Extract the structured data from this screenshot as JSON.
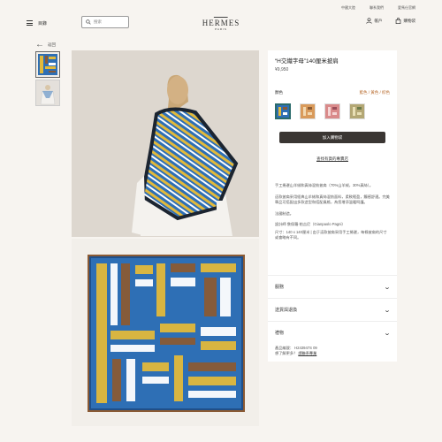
{
  "topbar": {
    "links": [
      "中國大陸",
      "聯系我們",
      "愛馬仕官網"
    ]
  },
  "header": {
    "menu_label": "目錄",
    "search_placeholder": "搜索",
    "logo_main": "HERMES",
    "logo_sub": "PARIS",
    "account_label": "帳戶",
    "cart_label": "購物袋"
  },
  "back": {
    "label": "返回"
  },
  "product": {
    "title": "“H交織字母”140厘米披肩",
    "price": "¥9,950",
    "color_heading": "顏色",
    "color_value": "藍色 / 黃色 / 棕色",
    "add_to_cart": "加入購物袋",
    "store_link": "查找有貨的專賣店",
    "desc_1": "手工捲邊山羊絨和真絲混紡披肩（70%山羊絨，30%真絲）。",
    "desc_2": "這款披肩采用經典山羊絨和真絲混紡面料，柔軟輕盈，觸感舒適。完美單品可搭配出多款造型和搭配風格，為您增添溫暖呵護。",
    "desc_3": "法國制造。",
    "designer": "設計師 詹保羅·帕吉尼（Gianpaolo Pagni）",
    "size_note": "尺寸：140 x 140厘米 | 由于這款披肩采用手工捲邊，每條披肩的尺寸或會略有不同。"
  },
  "accordion": [
    "服務",
    "送貨與退換",
    "禮物"
  ],
  "meta": {
    "product_code_label": "產品編號：",
    "product_code": "H243947S 09",
    "help_label": "想了解更多？",
    "contact_link": "請聯系專業"
  },
  "colors": {
    "accent": "#b96c2f",
    "button_bg": "#3a3633",
    "blue": "#2e6fb5",
    "yellow": "#e2b93b",
    "brown": "#8a5a34",
    "swatch_selected_border": "#2a6b6b"
  },
  "icons": [
    "menu-icon",
    "search-icon",
    "account-icon",
    "cart-icon",
    "back-arrow-icon",
    "chevron-down-icon"
  ]
}
